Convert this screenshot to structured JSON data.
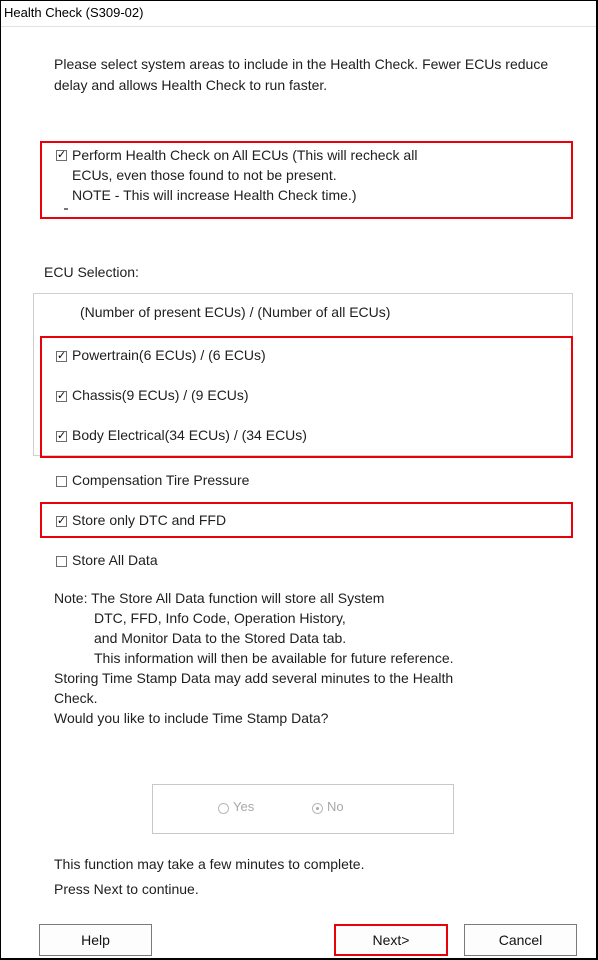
{
  "window": {
    "title": "Health Check (S309-02)"
  },
  "intro": "Please select system areas to include in the Health Check. Fewer ECUs reduce delay and allows Health Check to run faster.",
  "all_ecus": {
    "checked": true,
    "line1": "Perform Health Check on All ECUs (This will recheck all",
    "line2": "ECUs, even those found to not be present.",
    "line3": "NOTE - This will increase Health Check time.)"
  },
  "ecu_selection": {
    "heading": "ECU Selection:",
    "column_header": "(Number of present ECUs) / (Number of all ECUs)",
    "items": [
      {
        "label": "Powertrain(6 ECUs) / (6 ECUs)",
        "checked": true
      },
      {
        "label": "Chassis(9 ECUs) / (9 ECUs)",
        "checked": true
      },
      {
        "label": "Body Electrical(34 ECUs) / (34 ECUs)",
        "checked": true
      }
    ]
  },
  "options": {
    "compensation": {
      "label": "Compensation Tire Pressure",
      "checked": false
    },
    "store_dtc": {
      "label": "Store only DTC and FFD",
      "checked": true
    },
    "store_all": {
      "label": "Store All Data",
      "checked": false
    }
  },
  "note_lines": [
    "Note: The Store All Data function will store all System",
    "DTC, FFD, Info Code, Operation History,",
    "and Monitor Data to the Stored Data tab.",
    "This information will then be available for future reference.",
    "Storing Time Stamp Data may add several minutes to the Health",
    "Check.",
    "Would you like to include Time Stamp Data?"
  ],
  "time_stamp": {
    "yes_label": "Yes",
    "no_label": "No",
    "selected": "No"
  },
  "footer": {
    "line1": "This function may take a few minutes to complete.",
    "line2": "Press Next to continue."
  },
  "buttons": {
    "help": "Help",
    "next": "Next>",
    "cancel": "Cancel"
  }
}
